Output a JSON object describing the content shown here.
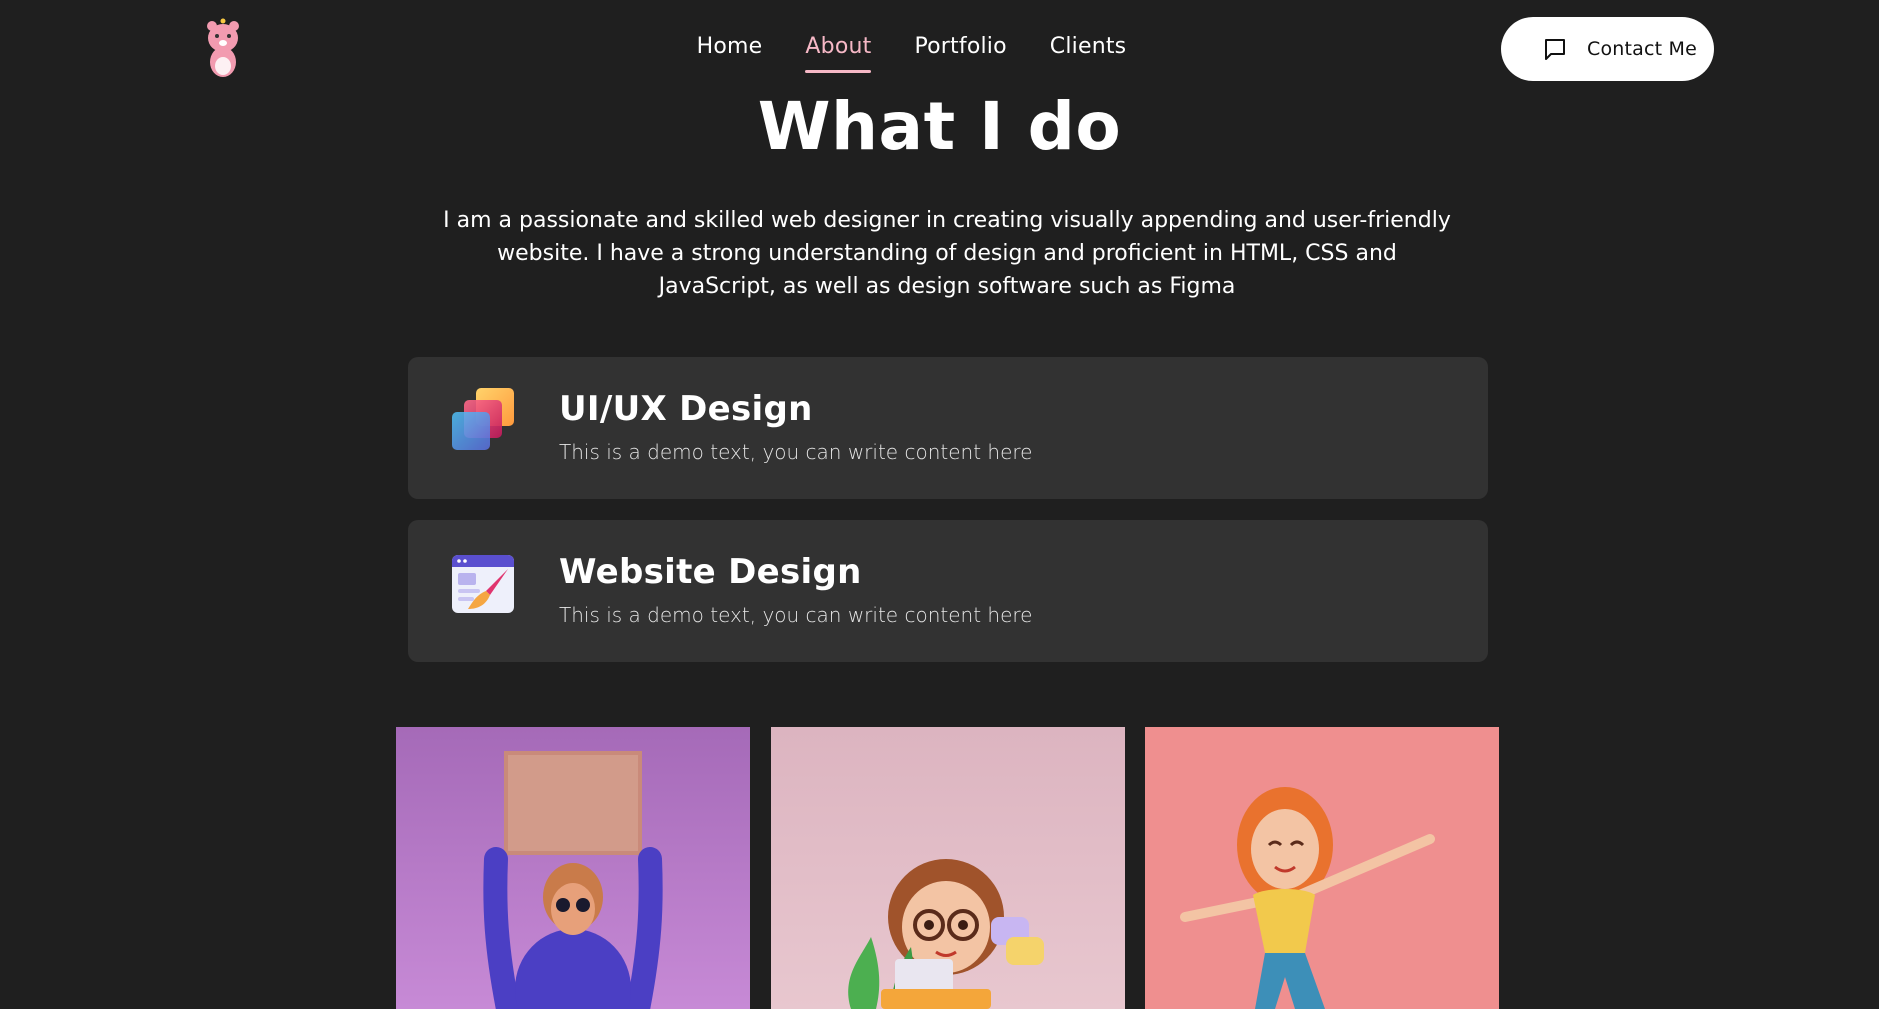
{
  "nav": {
    "items": [
      {
        "label": "Home"
      },
      {
        "label": "About"
      },
      {
        "label": "Portfolio"
      },
      {
        "label": "Clients"
      }
    ],
    "active": "About"
  },
  "contact": {
    "label": "Contact Me",
    "icon": "chat-icon"
  },
  "hero": {
    "title": "What I do",
    "intro": "I am a passionate and skilled web designer in creating visually appending and user-friendly website. I have a strong understanding of design and proficient in HTML, CSS and JavaScript, as well as design software such as Figma"
  },
  "services": [
    {
      "title": "UI/UX Design",
      "description": "This is a demo text, you can write content here",
      "icon": "layers-icon"
    },
    {
      "title": "Website Design",
      "description": "This is a demo text, you can write content here",
      "icon": "browser-brush-icon"
    }
  ],
  "colors": {
    "background": "#1f1f1f",
    "card": "#323232",
    "accent": "#f6b8c6"
  }
}
